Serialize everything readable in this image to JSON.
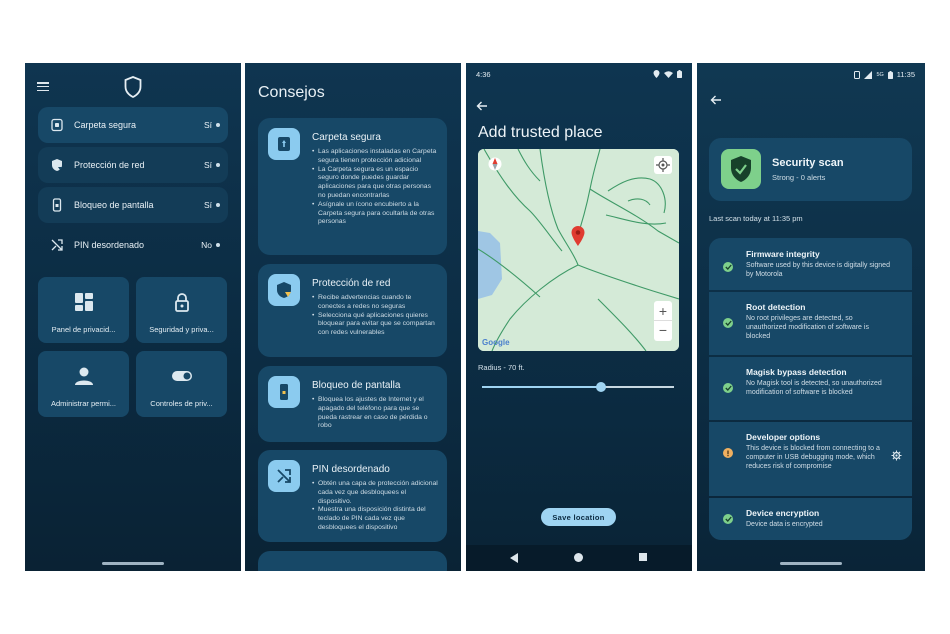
{
  "phone1": {
    "toggles": [
      {
        "label": "Carpeta segura",
        "value": "Sí"
      },
      {
        "label": "Protección de red",
        "value": "Sí"
      },
      {
        "label": "Bloqueo de pantalla",
        "value": "Sí"
      },
      {
        "label": "PIN desordenado",
        "value": "No"
      }
    ],
    "tiles": [
      {
        "label": "Panel de privacid..."
      },
      {
        "label": "Seguridad y priva..."
      },
      {
        "label": "Administrar permi..."
      },
      {
        "label": "Controles de priv..."
      }
    ]
  },
  "phone2": {
    "title": "Consejos",
    "tips": [
      {
        "title": "Carpeta segura",
        "bullets": [
          "Las aplicaciones instaladas en Carpeta segura tienen protección adicional",
          "La Carpeta segura es un espacio seguro donde puedes guardar aplicaciones para que otras personas no puedan encontrarlas",
          "Asígnale un ícono encubierto a la Carpeta segura para ocultarla de otras personas"
        ]
      },
      {
        "title": "Protección de red",
        "bullets": [
          "Recibe advertencias cuando te conectes a redes no seguras",
          "Selecciona qué aplicaciones quieres bloquear para evitar que se compartan con redes vulnerables"
        ]
      },
      {
        "title": "Bloqueo de pantalla",
        "bullets": [
          "Bloquea los ajustes de Internet y el apagado del teléfono para que se pueda rastrear en caso de pérdida o robo"
        ]
      },
      {
        "title": "PIN desordenado",
        "bullets": [
          "Obtén una capa de protección adicional cada vez que desbloquees el dispositivo.",
          "Muestra una disposición distinta del teclado de PIN cada vez que desbloquees el dispositivo"
        ]
      }
    ]
  },
  "phone3": {
    "time": "4:36",
    "title": "Add trusted place",
    "map_brand": "Google",
    "zoom_in": "+",
    "zoom_out": "−",
    "radius_label": "Radius - 70 ft.",
    "slider_fraction": 0.62,
    "save_label": "Save location"
  },
  "phone4": {
    "time": "11:35",
    "network": "5G",
    "scan_title": "Security scan",
    "scan_subtitle": "Strong - 0 alerts",
    "last_scan": "Last scan today at 11:35 pm",
    "checks": [
      {
        "title": "Firmware integrity",
        "desc": "Software used by this device is digitally signed by Motorola",
        "status": "ok"
      },
      {
        "title": "Root detection",
        "desc": "No root privileges are detected, so unauthorized modification of software is blocked",
        "status": "ok"
      },
      {
        "title": "Magisk bypass detection",
        "desc": "No Magisk tool is detected, so unauthorized modification of software is blocked",
        "status": "ok"
      },
      {
        "title": "Developer options",
        "desc": "This device is blocked from connecting to a computer in USB debugging mode, which reduces risk of compromise",
        "status": "info"
      },
      {
        "title": "Device encryption",
        "desc": "Device data is encrypted",
        "status": "ok"
      }
    ],
    "colors": {
      "ok": "#7ed08b",
      "info": "#f0b060"
    }
  }
}
